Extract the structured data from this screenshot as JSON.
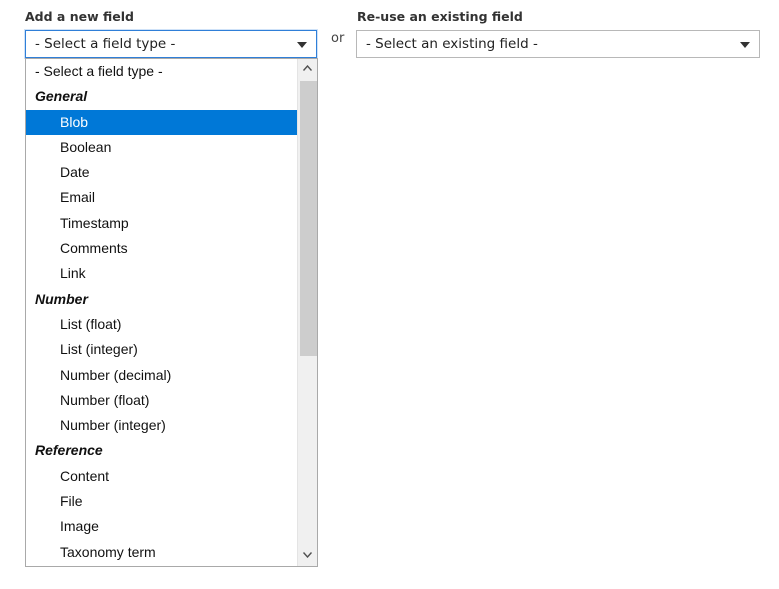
{
  "add_field": {
    "label": "Add a new field",
    "select_value": "- Select a field type -"
  },
  "separator": {
    "text": "or"
  },
  "existing_field": {
    "label": "Re-use an existing field",
    "select_value": "- Select an existing field -"
  },
  "dropdown": {
    "placeholder": "- Select a field type -",
    "groups": [
      {
        "label": "General",
        "items": [
          "Blob",
          "Boolean",
          "Date",
          "Email",
          "Timestamp",
          "Comments",
          "Link"
        ]
      },
      {
        "label": "Number",
        "items": [
          "List (float)",
          "List (integer)",
          "Number (decimal)",
          "Number (float)",
          "Number (integer)"
        ]
      },
      {
        "label": "Reference",
        "items": [
          "Content",
          "File",
          "Image",
          "Taxonomy term"
        ]
      }
    ],
    "selected_item": "Blob",
    "scroll_position": 0.0
  },
  "colors": {
    "selected_bg": "#0078d7",
    "focus_border": "#2f7fd8"
  }
}
